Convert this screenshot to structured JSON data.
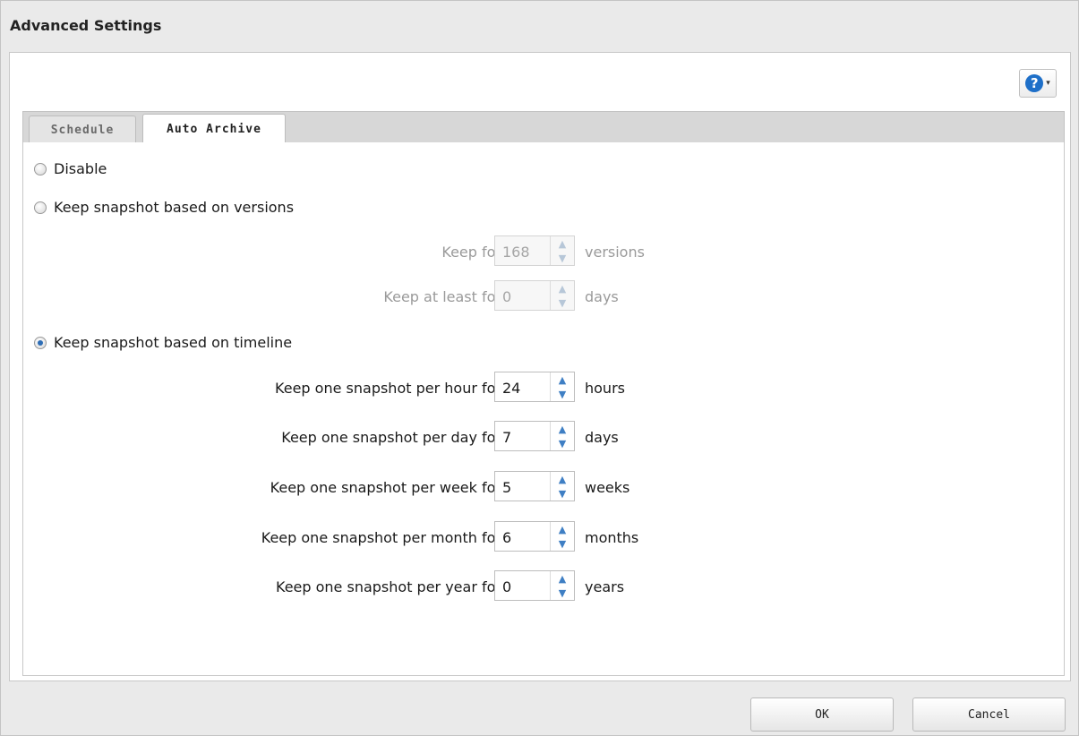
{
  "window": {
    "title": "Advanced Settings"
  },
  "help": {
    "icon": "help-icon",
    "symbol": "?",
    "caret": "▾"
  },
  "tabs": [
    {
      "label": "Schedule",
      "active": false
    },
    {
      "label": "Auto Archive",
      "active": true
    }
  ],
  "options": {
    "disable": {
      "label": "Disable",
      "checked": false
    },
    "versions": {
      "label": "Keep snapshot based on versions",
      "checked": false,
      "fields": [
        {
          "label": "Keep for",
          "value": "168",
          "unit": "versions"
        },
        {
          "label": "Keep at least for",
          "value": "0",
          "unit": "days"
        }
      ]
    },
    "timeline": {
      "label": "Keep snapshot based on timeline",
      "checked": true,
      "fields": [
        {
          "label": "Keep one snapshot per hour for",
          "value": "24",
          "unit": "hours"
        },
        {
          "label": "Keep one snapshot per day for",
          "value": "7",
          "unit": "days"
        },
        {
          "label": "Keep one snapshot per week for",
          "value": "5",
          "unit": "weeks"
        },
        {
          "label": "Keep one snapshot per month for",
          "value": "6",
          "unit": "months"
        },
        {
          "label": "Keep one snapshot per year for",
          "value": "0",
          "unit": "years"
        }
      ]
    }
  },
  "footer": {
    "ok_label": "OK",
    "cancel_label": "Cancel"
  },
  "colors": {
    "accent": "#1e6fc8",
    "spinner_arrow": "#3f7fc4"
  }
}
